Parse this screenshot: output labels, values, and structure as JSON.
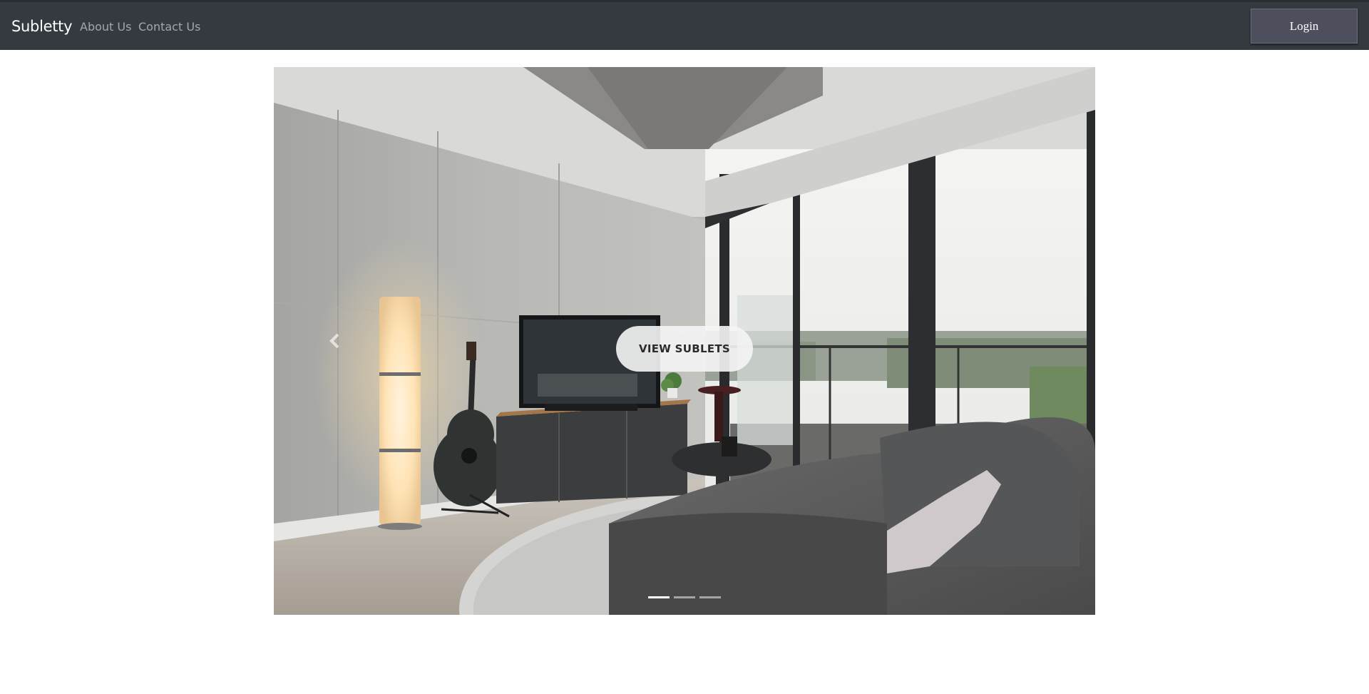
{
  "navbar": {
    "brand": "Subletty",
    "links": [
      "About Us",
      "Contact Us"
    ],
    "login_label": "Login"
  },
  "carousel": {
    "cta_label": "VIEW SUBLETS",
    "slide_count": 3,
    "active_slide": 1,
    "prev_icon": "chevron-left-icon",
    "slide_image": "modern-apartment-living-room-photo"
  },
  "colors": {
    "navbar_bg": "#343a40",
    "login_bg": "#4d505c",
    "page_bg": "#ffffff"
  }
}
